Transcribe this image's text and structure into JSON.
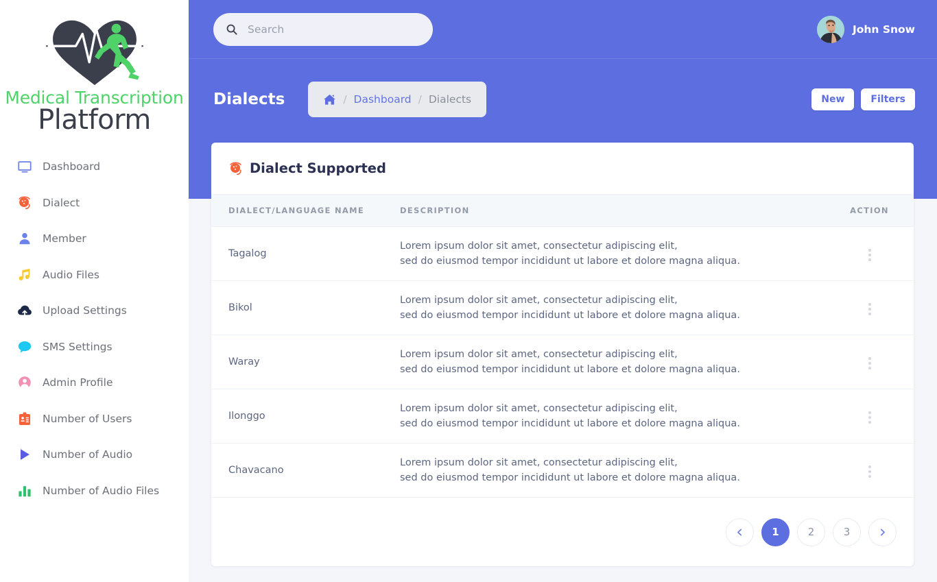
{
  "brand": {
    "logo_icon": "heart-ekg-runner-logo",
    "line1": "Medical Transcription",
    "line2": "Platform"
  },
  "colors": {
    "accent": "#5d6ee0",
    "page_bg": "#f4f6fa",
    "card_bg": "#ffffff",
    "table_header_bg": "#f5f8fb",
    "logo_green": "#4fd368",
    "logo_dark": "#3b3f4c",
    "dialect_orange": "#f4623a"
  },
  "sidebar": {
    "items": [
      {
        "label": "Dashboard",
        "icon": "monitor-icon"
      },
      {
        "label": "Dialect",
        "icon": "dialect-icon"
      },
      {
        "label": "Member",
        "icon": "person-icon"
      },
      {
        "label": "Audio Files",
        "icon": "music-note-icon"
      },
      {
        "label": "Upload Settings",
        "icon": "cloud-upload-icon"
      },
      {
        "label": "SMS Settings",
        "icon": "chat-bubble-icon"
      },
      {
        "label": "Admin Profile",
        "icon": "user-circle-icon"
      },
      {
        "label": "Number of Users",
        "icon": "id-badge-icon"
      },
      {
        "label": "Number of Audio",
        "icon": "play-triangle-icon"
      },
      {
        "label": "Number of Audio Files",
        "icon": "bar-chart-icon"
      }
    ]
  },
  "topbar": {
    "search": {
      "placeholder": "Search",
      "value": "",
      "icon": "search-icon"
    },
    "user": {
      "name": "John Snow",
      "avatar": "user-avatar"
    }
  },
  "page_head": {
    "title": "Dialects",
    "breadcrumb": {
      "home_icon": "home-icon",
      "separator": "/",
      "link": "Dashboard",
      "current": "Dialects"
    },
    "actions": [
      {
        "label": "New"
      },
      {
        "label": "Filters"
      }
    ]
  },
  "card": {
    "icon": "dialect-icon",
    "title": "Dialect Supported",
    "table": {
      "columns": [
        "DIALECT/LANGUAGE NAME",
        "DESCRIPTION",
        "ACTION"
      ],
      "rows": [
        {
          "name": "Tagalog",
          "desc_line1": "Lorem ipsum dolor sit amet, consectetur adipiscing elit,",
          "desc_line2": "sed do eiusmod tempor incididunt ut labore et dolore magna aliqua.",
          "action_icon": "kebab-menu-icon"
        },
        {
          "name": "Bikol",
          "desc_line1": "Lorem ipsum dolor sit amet, consectetur adipiscing elit,",
          "desc_line2": "sed do eiusmod tempor incididunt ut labore et dolore magna aliqua.",
          "action_icon": "kebab-menu-icon"
        },
        {
          "name": "Waray",
          "desc_line1": "Lorem ipsum dolor sit amet, consectetur adipiscing elit,",
          "desc_line2": "sed do eiusmod tempor incididunt ut labore et dolore magna aliqua.",
          "action_icon": "kebab-menu-icon"
        },
        {
          "name": "Ilonggo",
          "desc_line1": "Lorem ipsum dolor sit amet, consectetur adipiscing elit,",
          "desc_line2": "sed do eiusmod tempor incididunt ut labore et dolore magna aliqua.",
          "action_icon": "kebab-menu-icon"
        },
        {
          "name": "Chavacano",
          "desc_line1": "Lorem ipsum dolor sit amet, consectetur adipiscing elit,",
          "desc_line2": "sed do eiusmod tempor incididunt ut labore et dolore magna aliqua.",
          "action_icon": "kebab-menu-icon"
        }
      ]
    },
    "pagination": {
      "prev_icon": "chevron-left-icon",
      "next_icon": "chevron-right-icon",
      "pages": [
        "1",
        "2",
        "3"
      ],
      "active": "1"
    }
  }
}
